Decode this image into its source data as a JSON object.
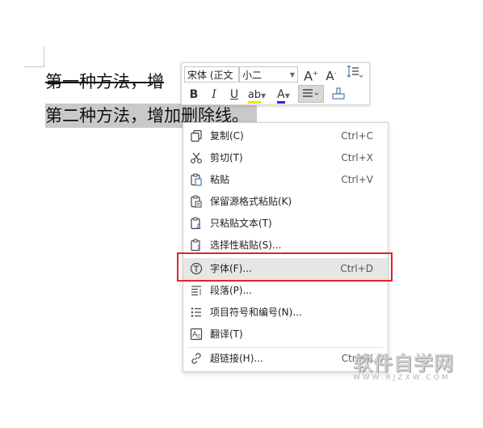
{
  "document": {
    "line1": "第一种方法，增",
    "line2": "第二种方法，增加删除线。"
  },
  "mini_toolbar": {
    "font_name": "宋体 (正文",
    "font_size": "小二",
    "bold": "B",
    "italic": "I",
    "underline": "U",
    "highlight": "ab",
    "font_color": "A",
    "grow_font": "A",
    "shrink_font": "A",
    "highlight_color": "#f5e400",
    "font_color_value": "#2b2bd6"
  },
  "context_menu": {
    "items": [
      {
        "label": "复制(C)",
        "shortcut": "Ctrl+C",
        "icon": "copy-icon"
      },
      {
        "label": "剪切(T)",
        "shortcut": "Ctrl+X",
        "icon": "scissors-icon"
      },
      {
        "label": "粘贴",
        "shortcut": "Ctrl+V",
        "icon": "paste-icon"
      },
      {
        "label": "保留源格式粘贴(K)",
        "shortcut": "",
        "icon": "paste-keep-format-icon"
      },
      {
        "label": "只粘贴文本(T)",
        "shortcut": "",
        "icon": "paste-text-icon"
      },
      {
        "label": "选择性粘贴(S)...",
        "shortcut": "",
        "icon": "paste-special-icon"
      },
      {
        "label": "字体(F)...",
        "shortcut": "Ctrl+D",
        "icon": "font-icon"
      },
      {
        "label": "段落(P)...",
        "shortcut": "",
        "icon": "paragraph-icon"
      },
      {
        "label": "项目符号和编号(N)...",
        "shortcut": "",
        "icon": "bullet-list-icon"
      },
      {
        "label": "翻译(T)",
        "shortcut": "",
        "icon": "translate-icon"
      },
      {
        "label": "超链接(H)...",
        "shortcut": "Ctrl+K",
        "icon": "link-icon"
      }
    ]
  },
  "watermark": {
    "big": "软件自学网",
    "small": "WWW.RJZXW.COM"
  }
}
